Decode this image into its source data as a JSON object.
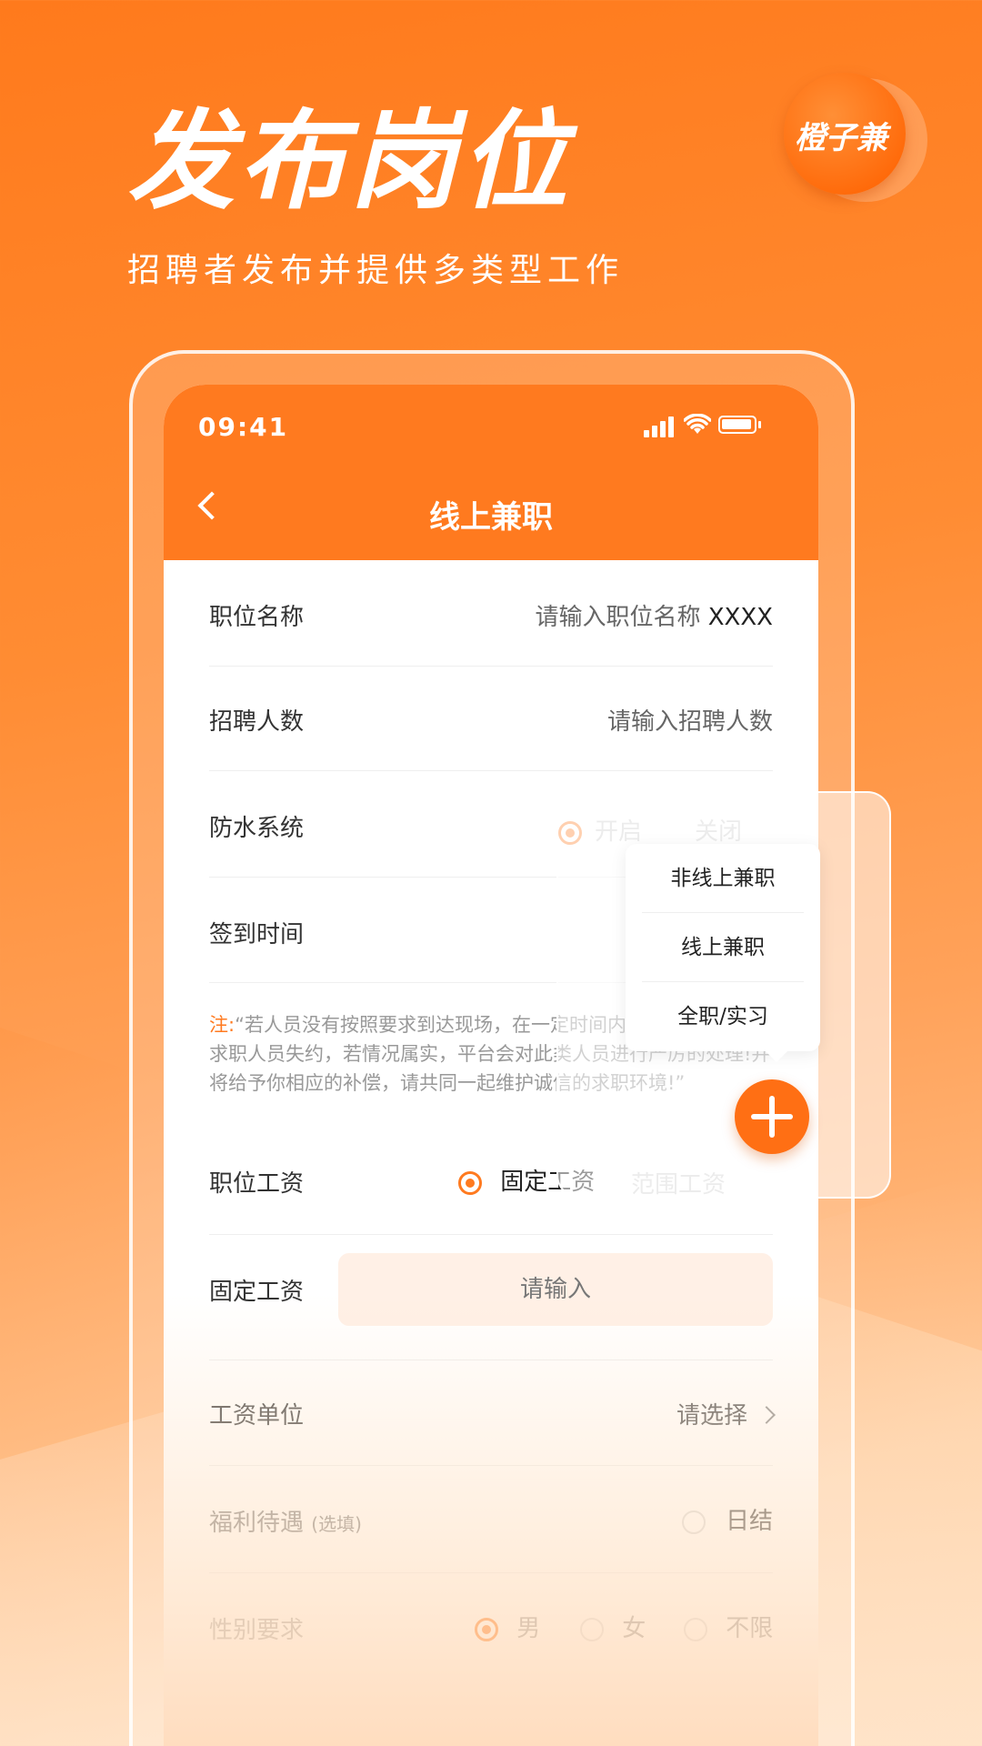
{
  "hero": {
    "title": "发布岗位",
    "subtitle": "招聘者发布并提供多类型工作",
    "logo_text": "橙子兼"
  },
  "status_bar": {
    "time": "09:41"
  },
  "nav": {
    "title": "线上兼职"
  },
  "form": {
    "job_name": {
      "label": "职位名称",
      "placeholder": "请输入职位名称",
      "typed": "XXXX"
    },
    "headcount": {
      "label": "招聘人数",
      "placeholder": "请输入招聘人数"
    },
    "anti_flake": {
      "label": "防水系统",
      "options": [
        "开启",
        "关闭"
      ]
    },
    "checkin_time": {
      "label": "签到时间"
    },
    "note": {
      "prefix": "注:",
      "text": "“若人员没有按照要求到达现场，在一定时间内请联系平台客服求职人员失约，若情况属实，平台会对此类人员进行严厉的处理!并将给予你相应的补偿，请共同一起维护诚信的求职环境!”"
    },
    "salary_type": {
      "label": "职位工资",
      "options": [
        "固定工资",
        "范围工资"
      ]
    },
    "fixed_salary": {
      "label": "固定工资",
      "placeholder": "请输入"
    },
    "salary_unit": {
      "label": "工资单位",
      "value": "请选择"
    },
    "benefits": {
      "label": "福利待遇",
      "label_note": "(选填)",
      "option": "日结"
    },
    "gender": {
      "label": "性别要求",
      "options": [
        "男",
        "女",
        "不限"
      ]
    }
  },
  "popup_menu": {
    "items": [
      "非线上兼职",
      "线上兼职",
      "全职/实习"
    ]
  },
  "colors": {
    "accent": "#ff7a1f",
    "fab": "#ff6f14"
  }
}
